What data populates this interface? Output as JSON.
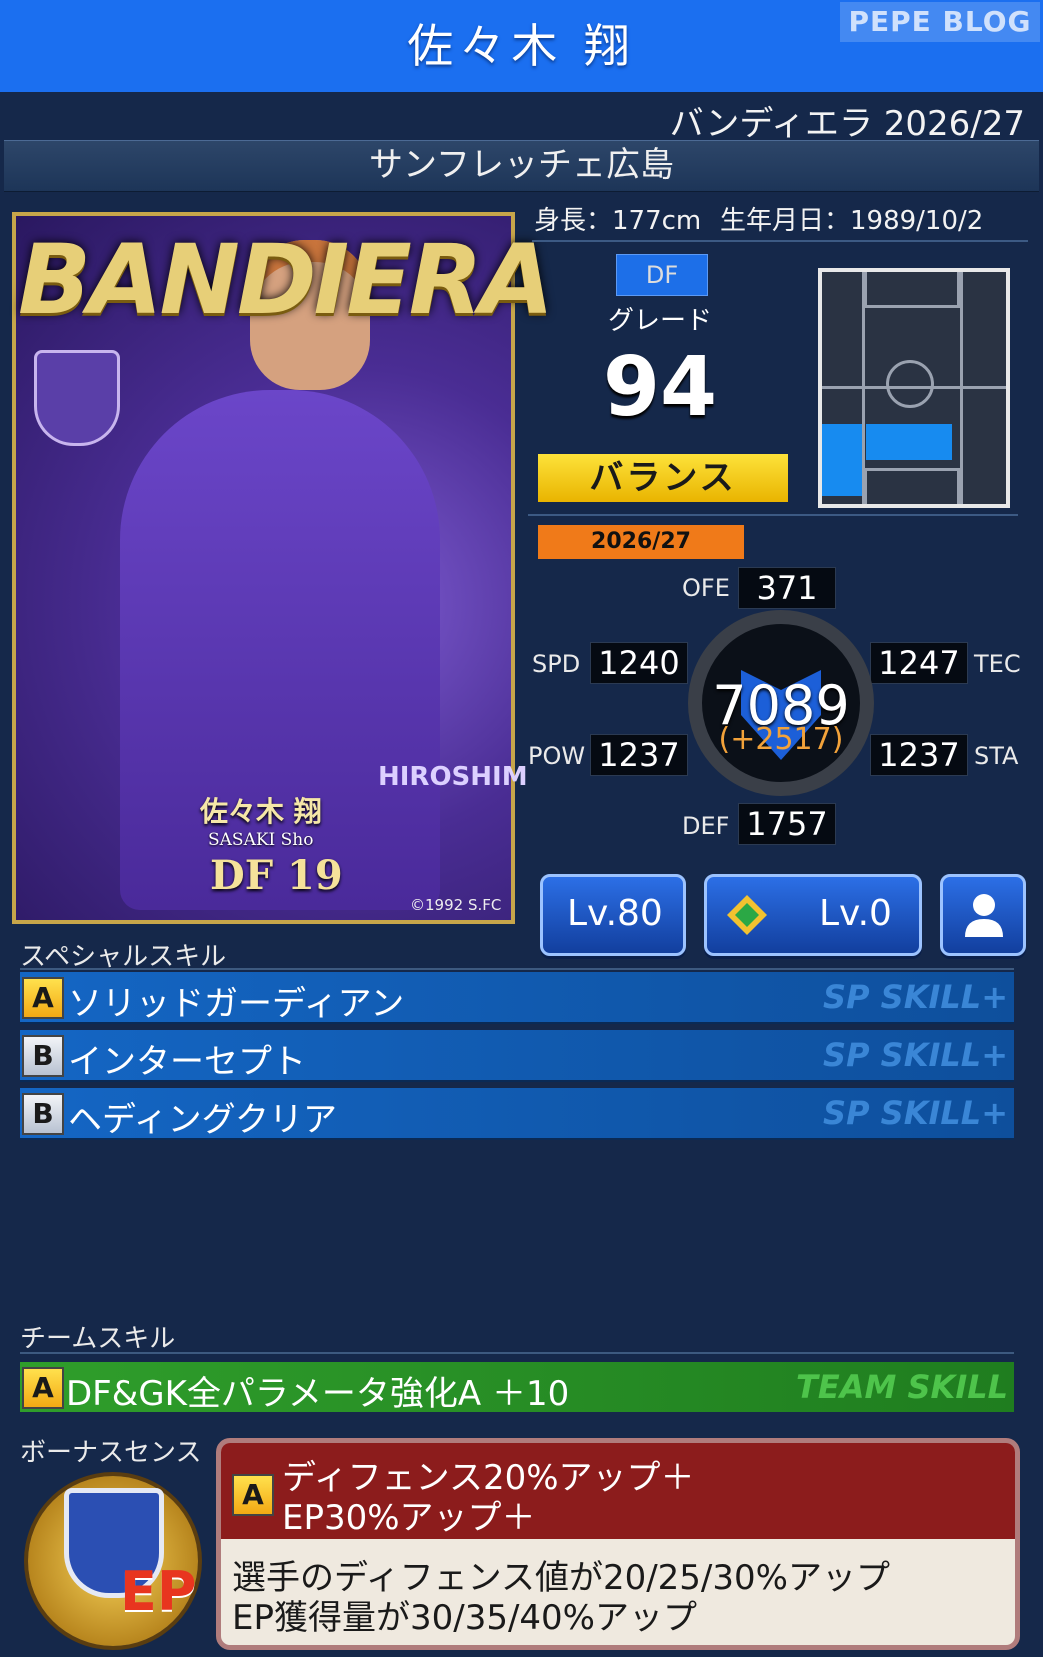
{
  "header": {
    "title": "佐々木 翔",
    "watermark": "PEPE BLOG"
  },
  "card_series": "バンディエラ 2026/27",
  "club": "サンフレッチェ広島",
  "card": {
    "banner": "BANDIERA",
    "name": "佐々木 翔",
    "roman": "SASAKI Sho",
    "number": "DF 19",
    "sponsor_text": "HIROSHIM",
    "copyright": "©1992 S.FC"
  },
  "profile": {
    "height": "身長：177cm",
    "birthday": "生年月日：1989/10/2",
    "position": "DF",
    "grade_label": "グレード",
    "grade": "94",
    "type": "バランス"
  },
  "stats": {
    "season": "2026/27",
    "ofe": {
      "label": "OFE",
      "value": "371"
    },
    "spd": {
      "label": "SPD",
      "value": "1240"
    },
    "tec": {
      "label": "TEC",
      "value": "1247"
    },
    "pow": {
      "label": "POW",
      "value": "1237"
    },
    "sta": {
      "label": "STA",
      "value": "1237"
    },
    "def": {
      "label": "DEF",
      "value": "1757"
    },
    "total": "7089",
    "bonus": "(+2517)"
  },
  "buttons": {
    "level": "Lv.80",
    "skill_level": "Lv.0"
  },
  "special_skills": {
    "label": "スペシャルスキル",
    "items": [
      {
        "grade": "A",
        "name": "ソリッドガーディアン",
        "tag": "SP SKILL+"
      },
      {
        "grade": "B",
        "name": "インターセプト",
        "tag": "SP SKILL+"
      },
      {
        "grade": "B",
        "name": "ヘディングクリア",
        "tag": "SP SKILL+"
      }
    ]
  },
  "team_skill": {
    "label": "チームスキル",
    "grade": "A",
    "name": "DF&GK全パラメータ強化A ＋10",
    "tag": "TEAM SKILL"
  },
  "bonus_sense": {
    "label": "ボーナスセンス",
    "grade": "A",
    "title_line1": "ディフェンス20%アップ＋",
    "title_line2": "EP30%アップ＋",
    "desc_line1": "選手のディフェンス値が20/25/30%アップ",
    "desc_line2": "EP獲得量が30/35/40%アップ",
    "emblem_text": "EP"
  },
  "colors": {
    "header": "#1b6ff0",
    "skill_row": "#1466c4",
    "team_row": "#2f9e2b",
    "bonus_head": "#8c1c1c",
    "type_badge": "#fde23a",
    "season_tag": "#f07a19"
  }
}
